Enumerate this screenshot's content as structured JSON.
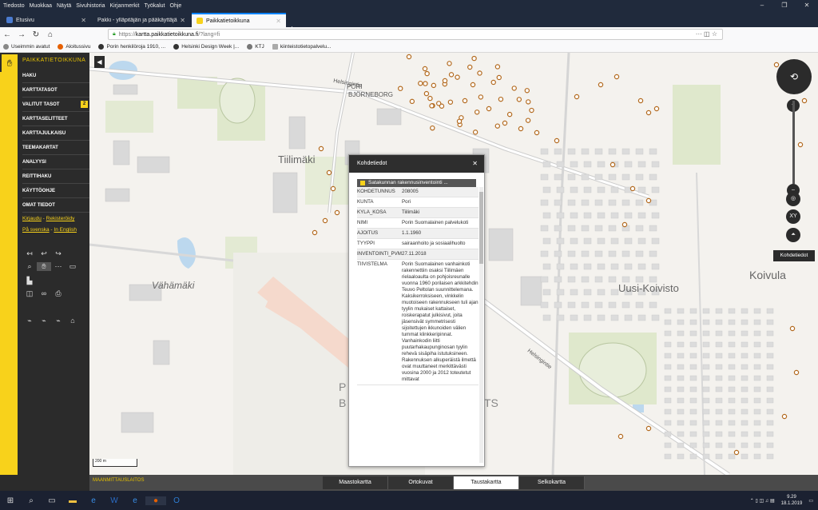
{
  "menubar": [
    "Tiedosto",
    "Muokkaa",
    "Näytä",
    "Sivuhistoria",
    "Kirjanmerkit",
    "Työkalut",
    "Ohje"
  ],
  "tabs": [
    {
      "label": "Etusivu"
    },
    {
      "label": "Pakki - ylläpitäjän ja pääkäyttäjän k"
    },
    {
      "label": "Paikkatietoikkuna"
    }
  ],
  "url": {
    "scheme": "https://",
    "host": "kartta.paikkatietoikkuna.fi",
    "rest": "/?lang=fi"
  },
  "bookmarks": [
    "Useimmin avatut",
    "Aloitussivu",
    "Porin henkilöroja 1910, ...",
    "Helsinki Design Week |...",
    "KTJ",
    "kiinteistotietopalvelu..."
  ],
  "sidebar": {
    "app_title": "PAIKKATIETOIKKUNA",
    "menu": [
      "HAKU",
      "KARTTATASOT",
      "VALITUT TASOT",
      "KARTTASELITTEET",
      "KARTTAJULKAISU",
      "TEEMAKARTAT",
      "ANALYYSI",
      "REITTIHAKU",
      "KÄYTTÖOHJE",
      "OMAT TIEDOT"
    ],
    "selected_badge": "2",
    "login_link": "Kirjaudu",
    "register_link": "Rekisteröidy",
    "swedish_link": "På svenska",
    "english_link": "In English"
  },
  "map": {
    "labels": {
      "pori": "PORI",
      "bjorneborg": "BJÖRNEBORG",
      "tiilimaki": "Tiilimäki",
      "vahamaki": "Vähämäki",
      "uusi_koivisto": "Uusi-Koivisto",
      "koivula": "Koivula",
      "helsingintie": "Helsingintie",
      "p_letter": "P",
      "b_letter": "B",
      "ts_letters": "TS"
    },
    "scale": "200 m"
  },
  "popup": {
    "title": "Kohdetiedot",
    "close": "✕",
    "layer": "Satakunnan rakennusinventointi ...",
    "rows": [
      {
        "k": "KOHDETUNNUS",
        "v": "208005"
      },
      {
        "k": "KUNTA",
        "v": "Pori"
      },
      {
        "k": "KYLA_KOSA",
        "v": "Tiilimäki"
      },
      {
        "k": "NIMI",
        "v": "Porin Suomalainen palvelukoti"
      },
      {
        "k": "AJOITUS",
        "v": "1.1.1960"
      },
      {
        "k": "TYYPPI",
        "v": "sairaanhoito ja sosiaalihuolto"
      },
      {
        "k": "INVENTOINTI_PVM",
        "v": "27.11.2018"
      },
      {
        "k": "TIIVISTELMA",
        "v": "Porin Suomalainen vanhainkoti rakennettiin osaksi Tiilimäen rielaaloaulta on pohjoisreunalle vuonna 1960 porilaisen arkkitehdin Teuvo Peltolan suunnittelemana. Kaksikerroksiseen, vinkkelin muotoiseen rakennukseen tuli ajan tyylin mukaiset kattaiset, roiskerapatut julkisivut, joita jäsensivät symmetrisesti sijoitettujen ikkunoiden välien tummat klinkkeripinnat. Vanhainkodin liitti puutarhakaupunginosan tyylin rehevä sisäpiha istutuksineen. Rakennuksen alkuperäistä ilmettä ovat muuttaneet merkittävästi vuosina 2000 ja 2012 toteutetut mittavat"
      }
    ]
  },
  "controls": {
    "xy": "XY",
    "tooltip": "Kohdetiedot"
  },
  "basemap_tabs": [
    "Maastokartta",
    "Ortokuvat",
    "Taustakartta",
    "Selkokartta"
  ],
  "basemap_active": "Taustakartta",
  "footer_logo": "MAANMITTAUSLAITOS",
  "taskbar": {
    "time": "9.29",
    "date": "18.1.2019"
  }
}
